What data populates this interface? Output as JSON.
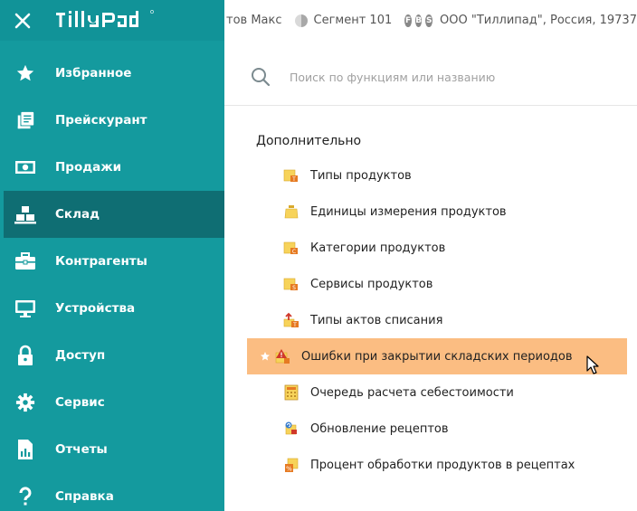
{
  "app": {
    "logo_text": "TillyPad"
  },
  "header": {
    "user": "тов Макс",
    "segment": "Сегмент 101",
    "badges": [
      "F",
      "B",
      "S"
    ],
    "organization": "ООО \"Тиллипад\", Россия, 19737"
  },
  "colors": {
    "sidebar": "#149a9e",
    "sidebar_active": "#0f6e73",
    "hover_row": "#fbbd82",
    "folder": "#f7d35a"
  },
  "sidebar": {
    "items": [
      {
        "label": "Избранное",
        "icon": "star-icon"
      },
      {
        "label": "Прейскурант",
        "icon": "price-list-icon"
      },
      {
        "label": "Продажи",
        "icon": "banknote-icon"
      },
      {
        "label": "Склад",
        "icon": "warehouse-icon",
        "active": true
      },
      {
        "label": "Контрагенты",
        "icon": "briefcase-icon"
      },
      {
        "label": "Устройства",
        "icon": "monitor-icon"
      },
      {
        "label": "Доступ",
        "icon": "lock-icon"
      },
      {
        "label": "Сервис",
        "icon": "gear-icon"
      },
      {
        "label": "Отчеты",
        "icon": "report-icon"
      },
      {
        "label": "Справка",
        "icon": "help-icon"
      }
    ]
  },
  "search": {
    "placeholder": "Поиск по функциям или названию"
  },
  "main": {
    "section_title": "Дополнительно",
    "items": [
      {
        "label": "Типы продуктов",
        "icon": "folder-product-type-icon"
      },
      {
        "label": "Единицы измерения продуктов",
        "icon": "weight-icon"
      },
      {
        "label": "Категории продуктов",
        "icon": "folder-category-icon"
      },
      {
        "label": "Сервисы продуктов",
        "icon": "folder-service-icon"
      },
      {
        "label": "Типы актов списания",
        "icon": "write-off-icon"
      },
      {
        "label": "Ошибки при закрытии складских периодов",
        "icon": "period-error-icon",
        "favorite": true,
        "hovered": true
      },
      {
        "label": "Очередь расчета себестоимости",
        "icon": "calculator-icon"
      },
      {
        "label": "Обновление рецептов",
        "icon": "recipe-update-icon"
      },
      {
        "label": "Процент обработки продуктов в рецептах",
        "icon": "recipe-percent-icon"
      }
    ]
  }
}
